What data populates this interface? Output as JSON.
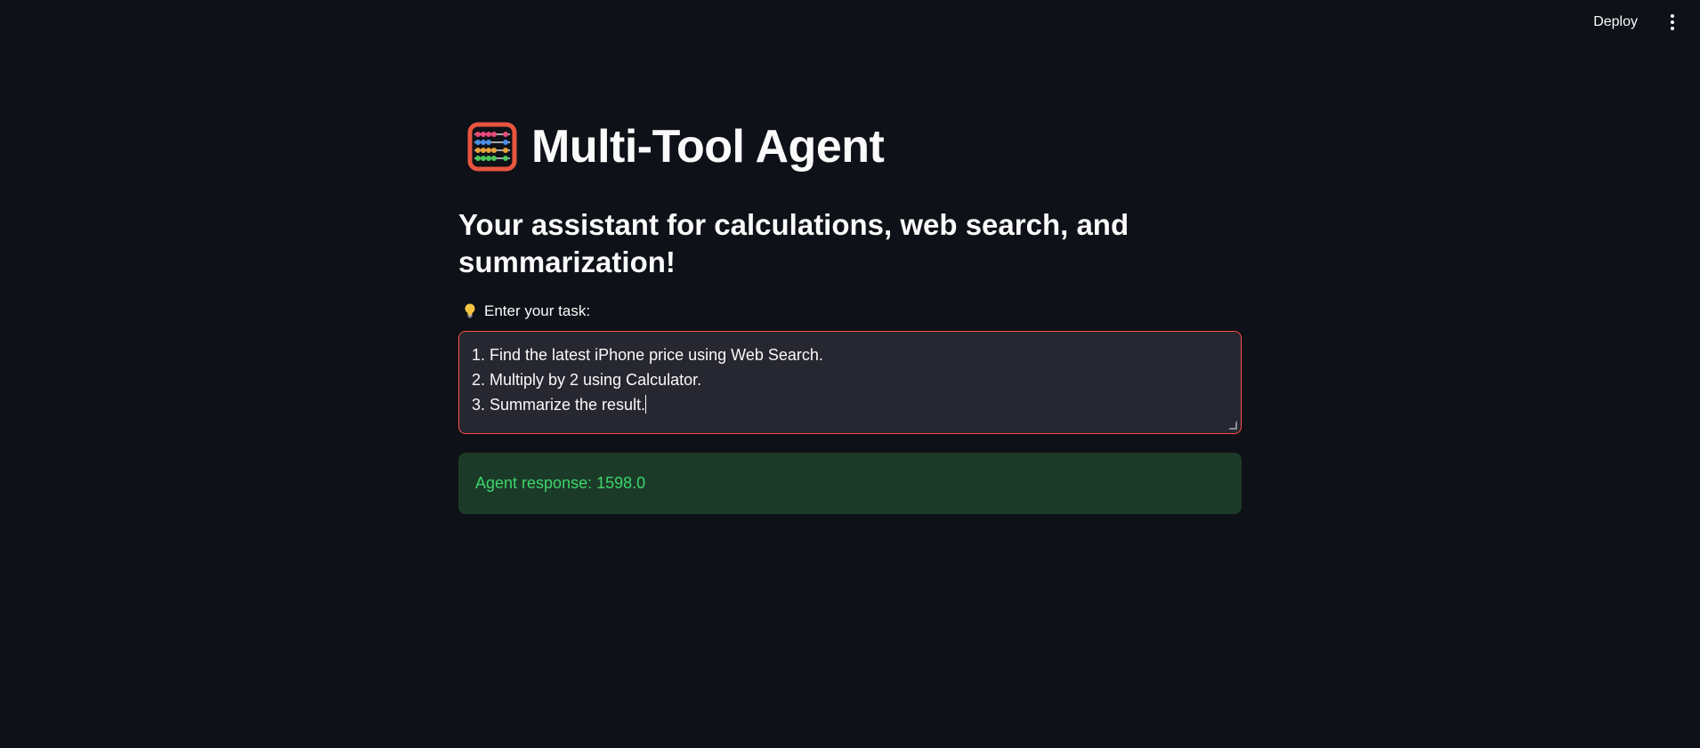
{
  "header": {
    "deploy_label": "Deploy",
    "menu_icon": "vertical-dots-icon"
  },
  "main": {
    "title_icon": "abacus-icon",
    "title": "Multi-Tool Agent",
    "subtitle": "Your assistant for calculations, web search, and summarization!",
    "task_field": {
      "label_icon": "lightbulb-icon",
      "label": "Enter your task:",
      "lines": [
        "1. Find the latest iPhone price using Web Search.",
        "2. Multiply by 2 using Calculator.",
        "3. Summarize the result."
      ]
    },
    "response": {
      "text": "Agent response: 1598.0"
    }
  },
  "colors": {
    "background": "#0e1117",
    "input_background": "#262730",
    "input_border_focus": "#ff4b4b",
    "success_background": "#1c3a28",
    "success_text": "#3dd56d"
  }
}
